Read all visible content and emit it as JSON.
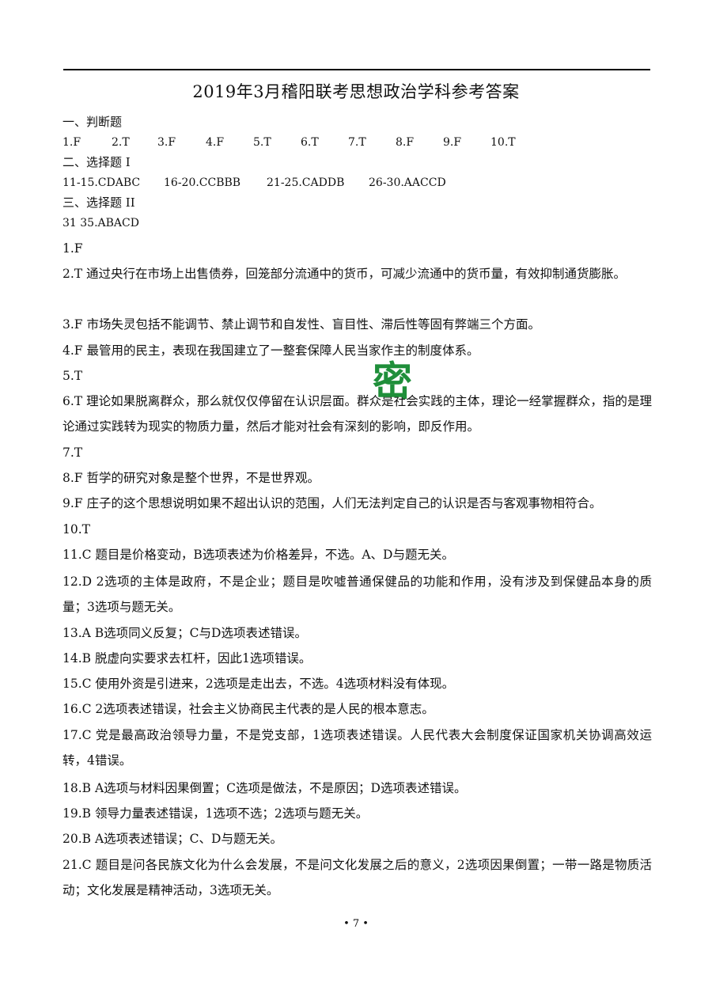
{
  "document": {
    "title": "2019年3月稽阳联考思想政治学科参考答案",
    "section1": {
      "heading": "一、判断题",
      "answers": [
        "1.F",
        "2.T",
        "3.F",
        "4.F",
        "5.T",
        "6.T",
        "7.T",
        "8.F",
        "9.F",
        "10.T"
      ]
    },
    "section2": {
      "heading": "二、选择题 I",
      "answers": [
        "11-15.CDABC",
        "16-20.CCBBB",
        "21-25.CADDB",
        "26-30.AACCD"
      ]
    },
    "section3": {
      "heading": "三、选择题 II",
      "answers": [
        "31 35.ABACD"
      ]
    },
    "explanations": [
      "1.F",
      "2.T 通过央行在市场上出售债券，回笼部分流通中的货币，可减少流通中的货币量，有效抑制通货膨胀。",
      "3.F 市场失灵包括不能调节、禁止调节和自发性、盲目性、滞后性等固有弊端三个方面。",
      "4.F 最管用的民主，表现在我国建立了一整套保障人民当家作主的制度体系。",
      "5.T",
      "6.T 理论如果脱离群众，那么就仅仅停留在认识层面。群众是社会实践的主体，理论一经掌握群众，指的是理论通过实践转为现实的物质力量，然后才能对社会有深刻的影响，即反作用。",
      "7.T",
      "8.F 哲学的研究对象是整个世界，不是世界观。",
      "9.F 庄子的这个思想说明如果不超出认识的范围，人们无法判定自己的认识是否与客观事物相符合。",
      "10.T",
      "11.C 题目是价格变动，B选项表述为价格差异，不选。A、D与题无关。",
      "12.D 2选项的主体是政府，不是企业；题目是吹嘘普通保健品的功能和作用，没有涉及到保健品本身的质量；3选项与题无关。",
      "13.A B选项同义反复；C与D选项表述错误。",
      "14.B 脱虚向实要求去杠杆，因此1选项错误。",
      "15.C 使用外资是引进来，2选项是走出去，不选。4选项材料没有体现。",
      "16.C 2选项表述错误，社会主义协商民主代表的是人民的根本意志。",
      "17.C 党是最高政治领导力量，不是党支部，1选项表述错误。人民代表大会制度保证国家机关协调高效运转，4错误。",
      "18.B A选项与材料因果倒置；C选项是做法，不是原因；D选项表述错误。",
      "19.B 领导力量表述错误，1选项不选；2选项与题无关。",
      "20.B A选项表述错误；C、D与题无关。",
      "21.C 题目是问各民族文化为什么会发展，不是问文化发展之后的意义，2选项因果倒置；一带一路是物质活动；文化发展是精神活动，3选项无关。"
    ],
    "watermark": "密",
    "page_number": "• 7 •"
  },
  "colors": {
    "watermark": "#1f8f3a",
    "text": "#111111"
  }
}
